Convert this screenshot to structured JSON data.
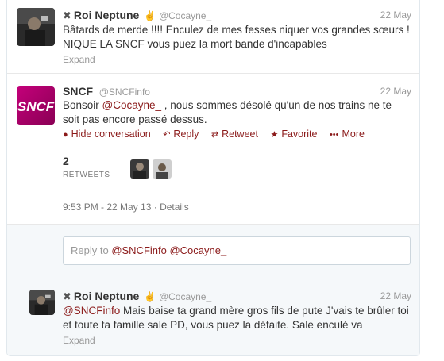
{
  "tweets": [
    {
      "name": "Roi Neptune",
      "badge": "✖",
      "screen": "@Cocayne_",
      "time": "22 May",
      "text": "Bâtards de merde !!!! Enculez de mes fesses niquer vos grandes sœurs ! NIQUE LA SNCF vous puez la mort bande d'incapables",
      "expand": "Expand"
    },
    {
      "name": "SNCF",
      "screen": "@SNCFinfo",
      "time": "22 May",
      "mention": "@Cocayne_",
      "text_before": "Bonsoir ",
      "text_after": " , nous sommes désolé qu'un de nos trains ne te soit pas encore passé dessus.",
      "actions": {
        "hide": "Hide conversation",
        "reply": "Reply",
        "retweet": "Retweet",
        "favorite": "Favorite",
        "more": "More"
      },
      "retweet_count": "2",
      "retweets_label": "RETWEETS",
      "timestamp": "9:53 PM - 22 May 13",
      "details": "Details"
    },
    {
      "name": "Roi Neptune",
      "badge": "✖",
      "screen": "@Cocayne_",
      "time": "22 May",
      "mention": "@SNCFinfo",
      "text_after": " Mais baise ta grand mère gros fils de pute J'vais te brûler toi et toute ta famille sale PD, vous puez la défaite. Sale enculé va",
      "expand": "Expand"
    }
  ],
  "reply_box": {
    "prefix": "Reply to ",
    "mentions": "@SNCFinfo @Cocayne_"
  },
  "colors": {
    "link": "#8b1a1a",
    "sncf_brand": "#a1006b",
    "border": "#e1e8ed"
  }
}
